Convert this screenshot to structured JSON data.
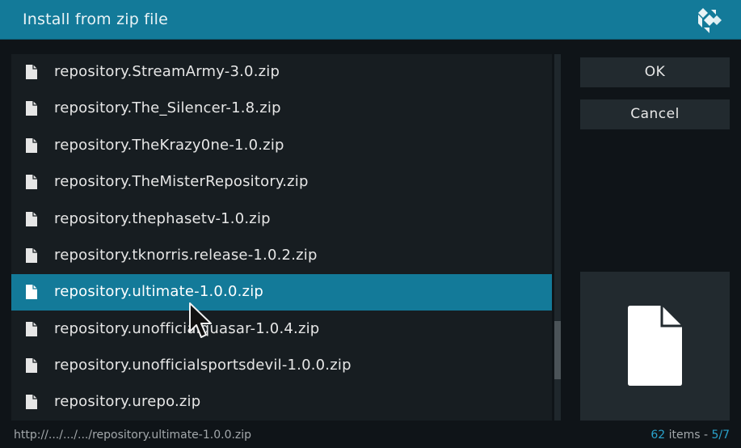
{
  "dialog": {
    "title": "Install from zip file",
    "logo_icon": "kodi-logo-icon"
  },
  "file_list": {
    "items": [
      {
        "name": "repository.StreamArmy-3.0.zip",
        "icon": "file-icon"
      },
      {
        "name": "repository.The_Silencer-1.8.zip",
        "icon": "file-icon"
      },
      {
        "name": "repository.TheKrazy0ne-1.0.zip",
        "icon": "file-icon"
      },
      {
        "name": "repository.TheMisterRepository.zip",
        "icon": "file-icon"
      },
      {
        "name": "repository.thephasetv-1.0.zip",
        "icon": "file-icon"
      },
      {
        "name": "repository.tknorris.release-1.0.2.zip",
        "icon": "file-icon"
      },
      {
        "name": "repository.ultimate-1.0.0.zip",
        "icon": "file-icon",
        "selected": true
      },
      {
        "name": "repository.unofficialquasar-1.0.4.zip",
        "icon": "file-icon"
      },
      {
        "name": "repository.unofficialsportsdevil-1.0.0.zip",
        "icon": "file-icon"
      },
      {
        "name": "repository.urepo.zip",
        "icon": "file-icon"
      }
    ]
  },
  "buttons": {
    "ok_label": "OK",
    "cancel_label": "Cancel"
  },
  "preview": {
    "icon": "file-icon"
  },
  "footer": {
    "path": "http://.../.../.../repository.ultimate-1.0.0.zip",
    "item_count": "62",
    "items_label": " items - ",
    "page": "5/7"
  },
  "colors": {
    "header": "#137a99",
    "selected_row": "#137a99",
    "accent_text": "#2aa3cc",
    "background": "#0f1418",
    "panel": "#171d21"
  }
}
